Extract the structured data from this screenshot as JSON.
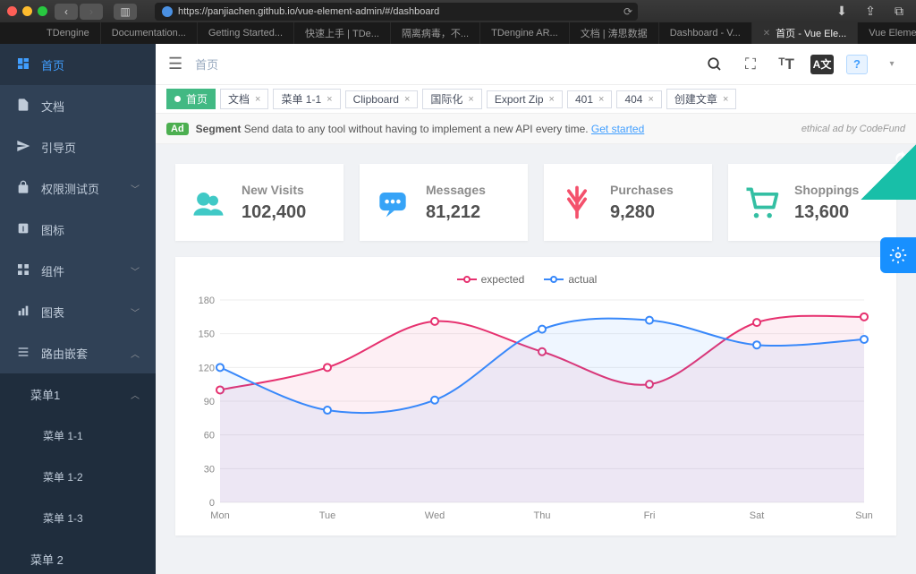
{
  "browser": {
    "url": "https://panjiachen.github.io/vue-element-admin/#/dashboard",
    "tabs": [
      {
        "label": "TDengine"
      },
      {
        "label": "Documentation..."
      },
      {
        "label": "Getting Started..."
      },
      {
        "label": "快速上手 | TDe..."
      },
      {
        "label": "隔离病毒，不..."
      },
      {
        "label": "TDengine AR..."
      },
      {
        "label": "文档 | 涛思数据"
      },
      {
        "label": "Dashboard - V..."
      },
      {
        "label": "首页 - Vue Ele...",
        "active": true
      },
      {
        "label": "Vue Element A..."
      }
    ]
  },
  "sidebar": {
    "items": [
      {
        "label": "首页",
        "icon": "dashboard",
        "active": true
      },
      {
        "label": "文档",
        "icon": "doc"
      },
      {
        "label": "引导页",
        "icon": "guide"
      },
      {
        "label": "权限测试页",
        "icon": "lock",
        "expand": true
      },
      {
        "label": "图标",
        "icon": "icon"
      },
      {
        "label": "组件",
        "icon": "component",
        "expand": true
      },
      {
        "label": "图表",
        "icon": "chart",
        "expand": true
      },
      {
        "label": "路由嵌套",
        "icon": "nested",
        "expand": true,
        "open": true
      }
    ],
    "nested": {
      "menu1": {
        "label": "菜单1",
        "open": true,
        "children": [
          "菜单 1-1",
          "菜单 1-2",
          "菜单 1-3"
        ]
      },
      "menu2": {
        "label": "菜单 2"
      }
    }
  },
  "topbar": {
    "breadcrumb": "首页"
  },
  "tags": [
    {
      "label": "首页",
      "active": true,
      "closable": false
    },
    {
      "label": "文档"
    },
    {
      "label": "菜单 1-1"
    },
    {
      "label": "Clipboard"
    },
    {
      "label": "国际化"
    },
    {
      "label": "Export Zip"
    },
    {
      "label": "401"
    },
    {
      "label": "404"
    },
    {
      "label": "创建文章"
    }
  ],
  "ad": {
    "badge": "Ad",
    "bold": "Segment",
    "text": " Send data to any tool without having to implement a new API every time. ",
    "link": "Get started",
    "ethical": "ethical ad by CodeFund"
  },
  "stats": [
    {
      "label": "New Visits",
      "value": "102,400",
      "color": "#40c9c6"
    },
    {
      "label": "Messages",
      "value": "81,212",
      "color": "#36a3f7"
    },
    {
      "label": "Purchases",
      "value": "9,280",
      "color": "#f4516c"
    },
    {
      "label": "Shoppings",
      "value": "13,600",
      "color": "#34bfa3"
    }
  ],
  "chart_data": {
    "type": "line",
    "legend": [
      "expected",
      "actual"
    ],
    "categories": [
      "Mon",
      "Tue",
      "Wed",
      "Thu",
      "Fri",
      "Sat",
      "Sun"
    ],
    "series": [
      {
        "name": "expected",
        "color": "#e6316f",
        "values": [
          100,
          120,
          161,
          134,
          105,
          160,
          165
        ]
      },
      {
        "name": "actual",
        "color": "#3888fa",
        "values": [
          120,
          82,
          91,
          154,
          162,
          140,
          145
        ]
      }
    ],
    "ylabel": "",
    "ylim": [
      0,
      180
    ],
    "yticks": [
      0,
      30,
      60,
      90,
      120,
      150,
      180
    ]
  }
}
